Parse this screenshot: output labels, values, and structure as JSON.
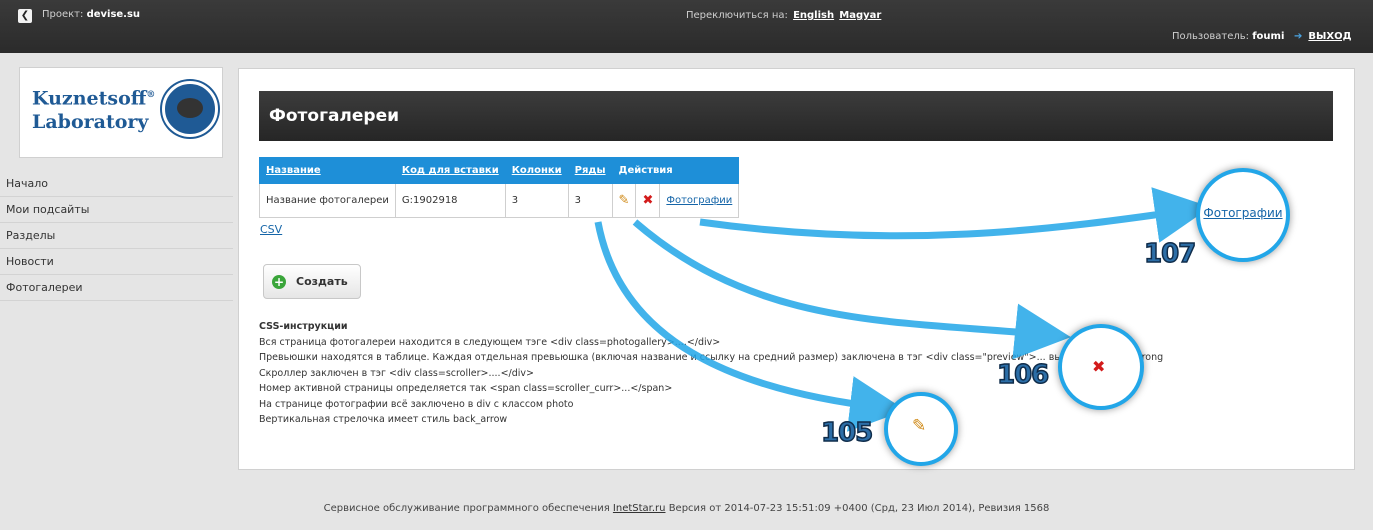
{
  "topbar": {
    "back_icon": "chevron-left-icon",
    "project_label": "Проект:",
    "project_name": "devise.su",
    "switch_label": "Переключиться на:",
    "lang_english": "English",
    "lang_magyar": "Magyar",
    "users_label": "Пользователь:",
    "user_name": "foumi",
    "logout_label": "ВЫХОД"
  },
  "logo": {
    "line1": "Kuznetsoff",
    "reg": "®",
    "line2": "Laboratory"
  },
  "sidebar": {
    "items": [
      {
        "label": "Начало"
      },
      {
        "label": "Мои подсайты"
      },
      {
        "label": "Разделы"
      },
      {
        "label": "Новости"
      },
      {
        "label": "Фотогалереи"
      }
    ]
  },
  "main": {
    "title": "Фотогалереи",
    "table": {
      "headers": [
        "Название",
        "Код для вставки",
        "Колонки",
        "Ряды",
        "Действия"
      ],
      "rows": [
        {
          "name": "Название фотогалереи",
          "code": "G:1902918",
          "cols": "3",
          "rows": "3",
          "photos_link": "Фотографии"
        }
      ]
    },
    "csv_link": "CSV",
    "create_button": "Создать",
    "css_title": "CSS-инструкции",
    "css_lines": [
      "Вся страница фотогалереи находится в следующем тэге <div class=photogallery>....</div>",
      "Превьюшки находятся в таблице. Каждая отдельная превьюшка (включая название и ссылку на средний размер) заключена в тэг <div class=\"preview\">... выделено тэгом strong",
      "Скроллер заключен в тэг <div class=scroller>....</div>",
      "Номер активной страницы определяется так <span class=scroller_curr>...</span>",
      "На странице фотографии всё заключено в div с классом photo",
      "Вертикальная стрелочка имеет стиль back_arrow"
    ]
  },
  "callouts": {
    "photos_label": "Фотографии",
    "n105": "105",
    "n106": "106",
    "n107": "107"
  },
  "footer": {
    "prefix": "Сервисное обслуживание программного обеспечения",
    "link": "InetStar.ru",
    "suffix": "Версия от 2014-07-23 15:51:09 +0400 (Срд, 23 Июл 2014), Ревизия 1568"
  },
  "colors": {
    "accent": "#1e8fd8",
    "header_dark": "#2b2b2b",
    "brand": "#1f5a95"
  }
}
